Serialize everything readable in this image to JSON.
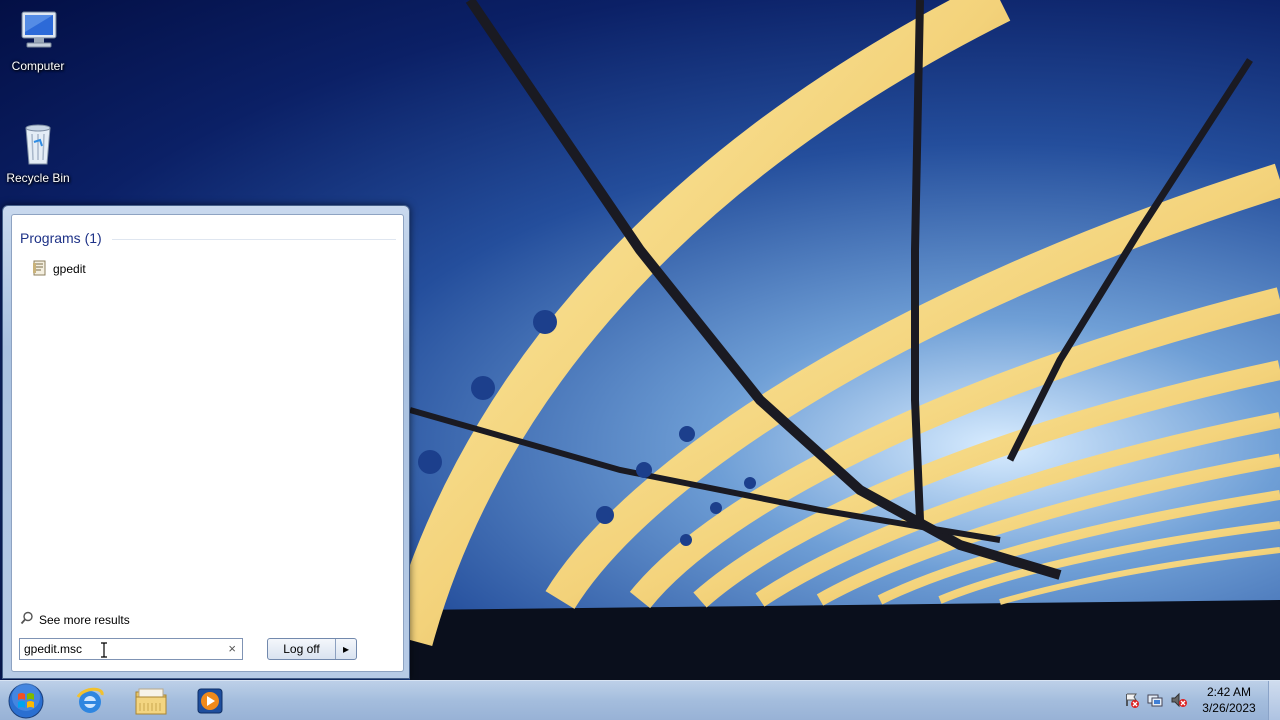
{
  "desktop": {
    "icons": [
      {
        "label": "Computer",
        "icon": "computer-icon"
      },
      {
        "label": "Recycle Bin",
        "icon": "recycle-bin-icon"
      }
    ]
  },
  "start_menu": {
    "results_header": "Programs (1)",
    "results": [
      {
        "label": "gpedit",
        "icon": "msc-file-icon"
      }
    ],
    "see_more_label": "See more results",
    "search": {
      "value": "gpedit.msc",
      "clear_glyph": "×"
    },
    "logoff_label": "Log off",
    "logoff_arrow_glyph": "▸"
  },
  "taskbar": {
    "apps": [
      {
        "icon": "internet-explorer-icon"
      },
      {
        "icon": "file-explorer-icon"
      },
      {
        "icon": "media-player-icon"
      }
    ],
    "tray_icons": [
      "action-center-icon",
      "network-icon",
      "volume-muted-icon"
    ],
    "clock": {
      "time": "2:42 AM",
      "date": "3/26/2023"
    }
  },
  "colors": {
    "header_text": "#1e3287",
    "taskbar": "#a4bddd",
    "start_menu_frame": "#a9c1e0"
  }
}
